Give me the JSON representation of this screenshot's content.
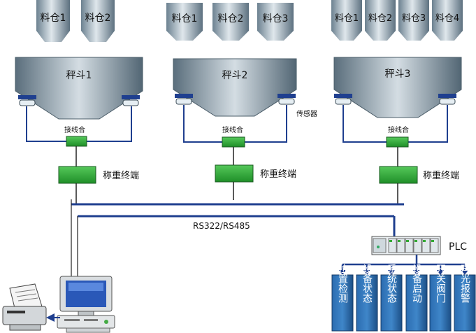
{
  "groups": [
    {
      "silos": [
        "料仓1",
        "料仓2"
      ],
      "hopper": "秤斗1",
      "junction": "接线合",
      "terminal": "称重终端"
    },
    {
      "silos": [
        "料仓1",
        "料仓2",
        "料仓3"
      ],
      "hopper": "秤斗2",
      "junction": "接线合",
      "terminal": "称重终端",
      "sensor": "传感器"
    },
    {
      "silos": [
        "料仓1",
        "料仓2",
        "料仓3",
        "料仓4"
      ],
      "hopper": "秤斗3",
      "junction": "接线合",
      "terminal": "称重终端"
    }
  ],
  "bus_label": "RS322/RS485",
  "plc_label": "PLC",
  "plc_modules": [
    "位置检测",
    "设备状态",
    "系统状态",
    "设备启动",
    "开关阀门",
    "声光报警"
  ],
  "colors": {
    "bus": "#1f3f8f",
    "terminal": "#2aa632",
    "module": "#1f5f9f",
    "hopper_dark": "#5f7482",
    "hopper_light": "#d7e0e6"
  }
}
